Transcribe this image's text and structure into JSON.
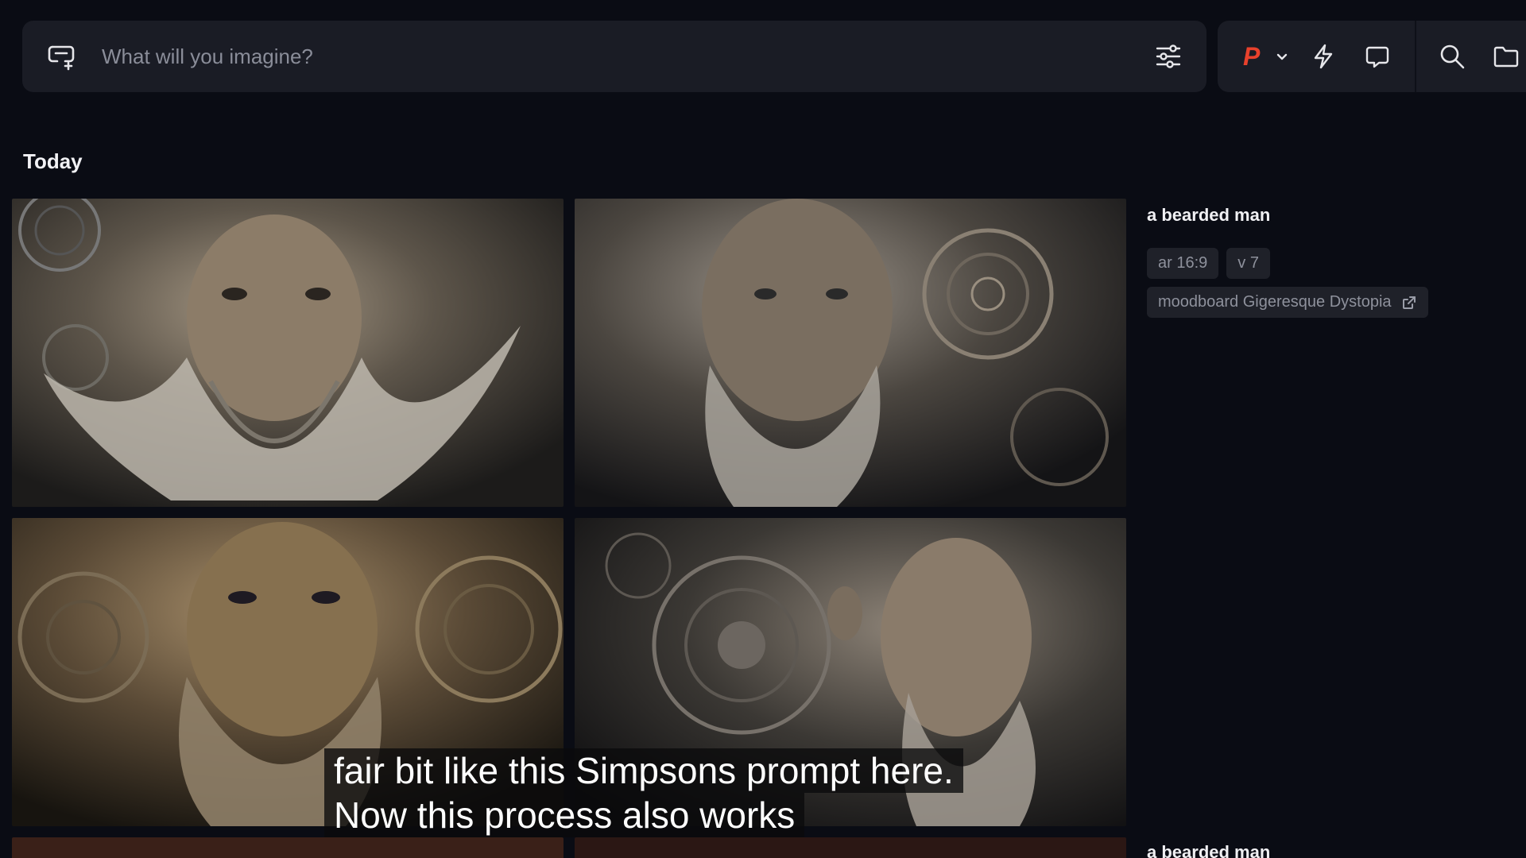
{
  "searchbar": {
    "placeholder": "What will you imagine?"
  },
  "toolbar": {
    "logo_letter": "P"
  },
  "section": {
    "title": "Today"
  },
  "job1": {
    "prompt": "a bearded man",
    "chips": [
      "ar 16:9",
      "v 7"
    ],
    "moodboard": "moodboard Gigeresque Dystopia"
  },
  "job2": {
    "prompt": "a bearded man"
  },
  "caption": {
    "line1": "fair bit like this Simpsons prompt here.",
    "line2": "Now this process also works"
  },
  "colors": {
    "accent": "#e8412c",
    "background": "#0a0c14",
    "panel": "#1a1c25",
    "chip": "#1f2129"
  },
  "icons": [
    "prompt-icon",
    "settings-sliders-icon",
    "chevron-down-icon",
    "bolt-icon",
    "chat-icon",
    "search-icon",
    "folder-icon",
    "external-link-icon"
  ]
}
